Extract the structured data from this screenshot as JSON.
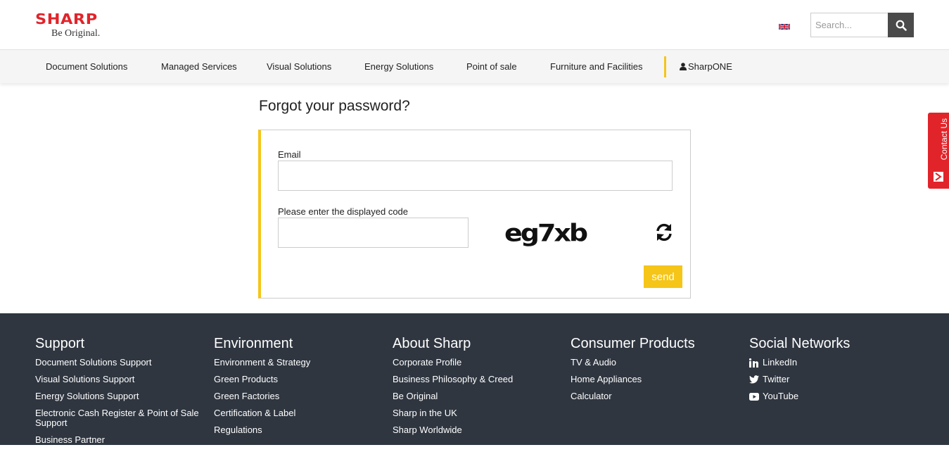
{
  "header": {
    "logo_brand": "SHARP",
    "logo_tagline": "Be Original.",
    "search_placeholder": "Search..."
  },
  "nav": {
    "items": [
      "Document Solutions",
      "Managed Services",
      "Visual Solutions",
      "Energy Solutions",
      "Point of sale",
      "Furniture and Facilities"
    ],
    "account": "SharpONE"
  },
  "main": {
    "title": "Forgot your password?",
    "email_label": "Email",
    "email_value": "",
    "code_label": "Please enter the displayed code",
    "code_value": "",
    "captcha_text": "eg7xb",
    "send_label": "send"
  },
  "contact_tab": {
    "label": "Contact Us"
  },
  "footer": {
    "columns": [
      {
        "heading": "Support",
        "links": [
          "Document Solutions Support",
          "Visual Solutions Support",
          "Energy Solutions Support",
          "Electronic Cash Register & Point of Sale Support",
          "Business Partner"
        ]
      },
      {
        "heading": "Environment",
        "links": [
          "Environment & Strategy",
          "Green Products",
          "Green Factories",
          "Certification & Label",
          "Regulations"
        ]
      },
      {
        "heading": "About Sharp",
        "links": [
          "Corporate Profile",
          "Business Philosophy & Creed",
          "Be Original",
          "Sharp in the UK",
          "Sharp Worldwide"
        ]
      },
      {
        "heading": "Consumer Products",
        "links": [
          "TV & Audio",
          "Home Appliances",
          "Calculator"
        ]
      },
      {
        "heading": "Social Networks",
        "links": [
          "LinkedIn",
          "Twitter",
          "YouTube"
        ]
      }
    ]
  },
  "colors": {
    "brand_red": "#e1242a",
    "accent_yellow": "#f5c518",
    "footer_bg": "#2f3640"
  }
}
